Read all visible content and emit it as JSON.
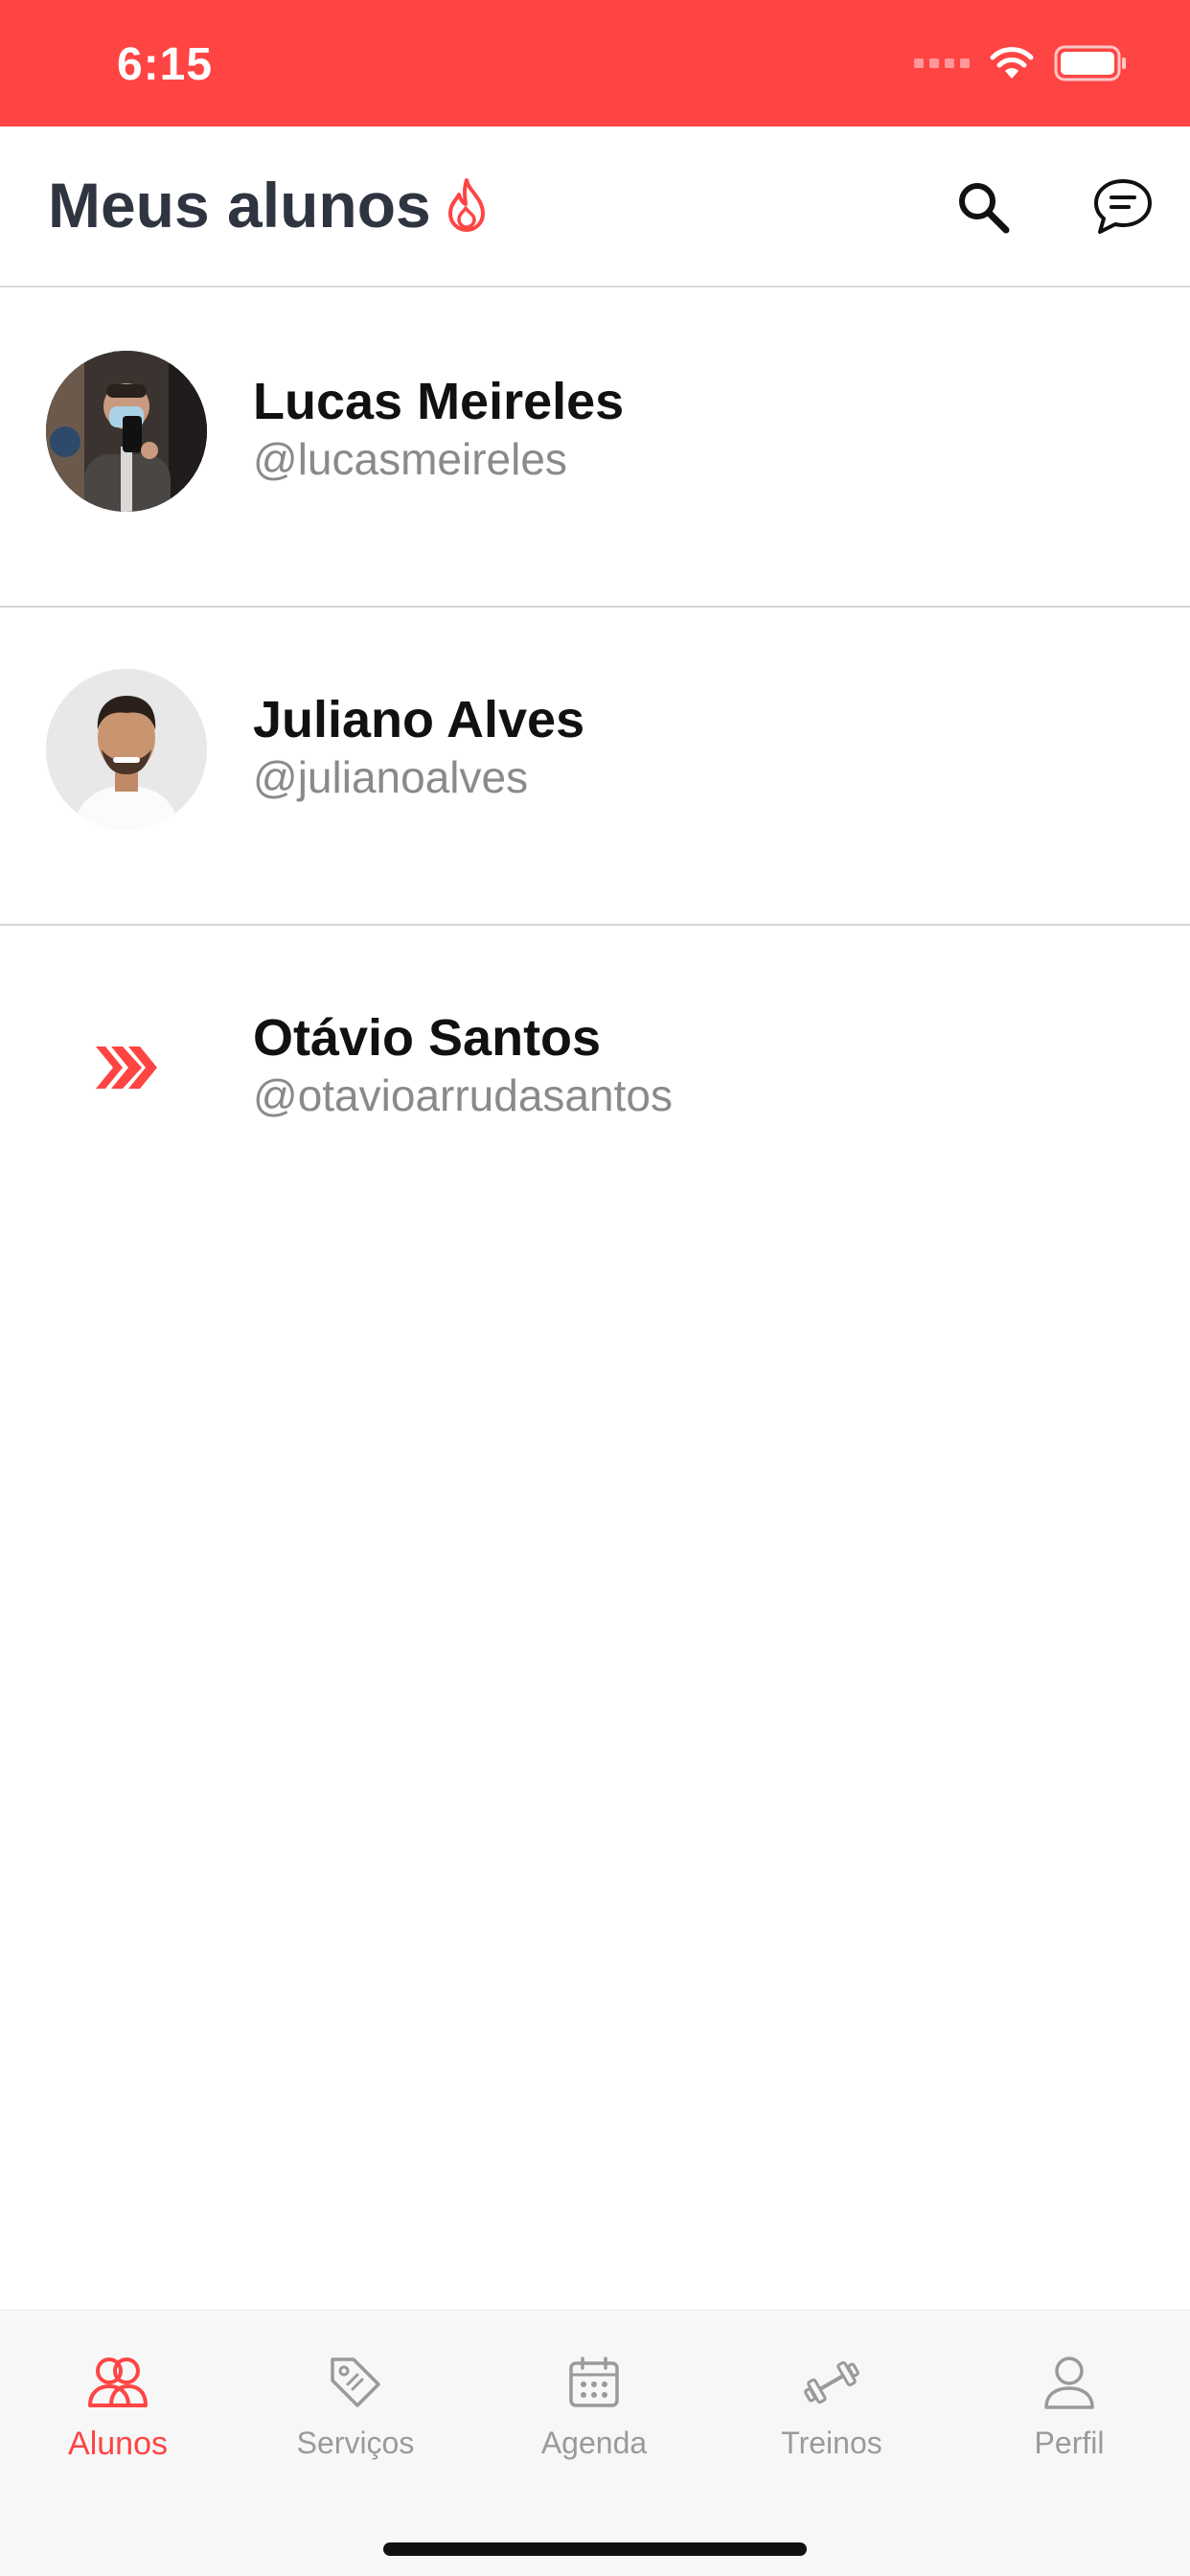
{
  "status_bar": {
    "time": "6:15",
    "icons": [
      "signal-dots-icon",
      "wifi-icon",
      "battery-icon"
    ],
    "background_color": "#FF4444"
  },
  "header": {
    "title": "Meus alunos",
    "title_icon": "flame-icon",
    "actions": [
      "search-icon",
      "chat-icon"
    ]
  },
  "students": [
    {
      "name": "Lucas Meireles",
      "handle": "@lucasmeireles",
      "avatar": "photo"
    },
    {
      "name": "Juliano Alves",
      "handle": "@julianoalves",
      "avatar": "photo"
    },
    {
      "name": "Otávio Santos",
      "handle": "@otavioarrudasantos",
      "avatar": "chevrons-logo"
    }
  ],
  "tab_bar": {
    "tabs": [
      {
        "label": "Alunos",
        "icon": "users-icon",
        "active": true
      },
      {
        "label": "Serviços",
        "icon": "tag-icon",
        "active": false
      },
      {
        "label": "Agenda",
        "icon": "calendar-icon",
        "active": false
      },
      {
        "label": "Treinos",
        "icon": "dumbbell-icon",
        "active": false
      },
      {
        "label": "Perfil",
        "icon": "person-icon",
        "active": false
      }
    ]
  },
  "colors": {
    "accent": "#FF4444",
    "title": "#2F3540",
    "handle": "#8A8A8A",
    "inactive_tab": "#9A9A9A"
  }
}
